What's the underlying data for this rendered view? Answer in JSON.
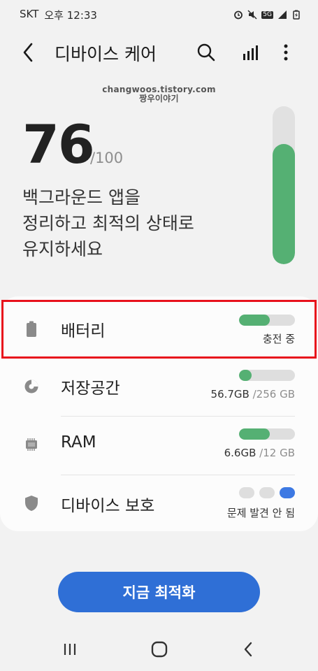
{
  "status_bar": {
    "carrier": "SKT",
    "time": "오후 12:33",
    "network": "5G"
  },
  "app_bar": {
    "title": "디바이스 케어"
  },
  "watermark": {
    "line1": "changwoos.tistory.com",
    "line2": "짱우이야기"
  },
  "score": {
    "value": "76",
    "max_label": "/100",
    "fill_fraction": 0.76,
    "description": [
      "백그라운드 앱을",
      "정리하고 최적의 상태로",
      "유지하세요"
    ]
  },
  "colors": {
    "accent_green": "#55b073",
    "accent_blue": "#2f6fd6",
    "highlight_red": "#e8121c"
  },
  "items": [
    {
      "label": "배터리",
      "icon": "battery-icon",
      "detail": "충전 중",
      "fill_fraction": 0.55
    },
    {
      "label": "저장공간",
      "icon": "pie-chart-icon",
      "used": "56.7GB",
      "total": "/256 GB",
      "fill_fraction": 0.22
    },
    {
      "label": "RAM",
      "icon": "chip-icon",
      "used": "6.6GB",
      "total": "/12 GB",
      "fill_fraction": 0.55
    },
    {
      "label": "디바이스 보호",
      "icon": "shield-icon",
      "detail": "문제 발견 안 됨",
      "level": 3
    }
  ],
  "optimize_button": {
    "label": "지금 최적화"
  }
}
